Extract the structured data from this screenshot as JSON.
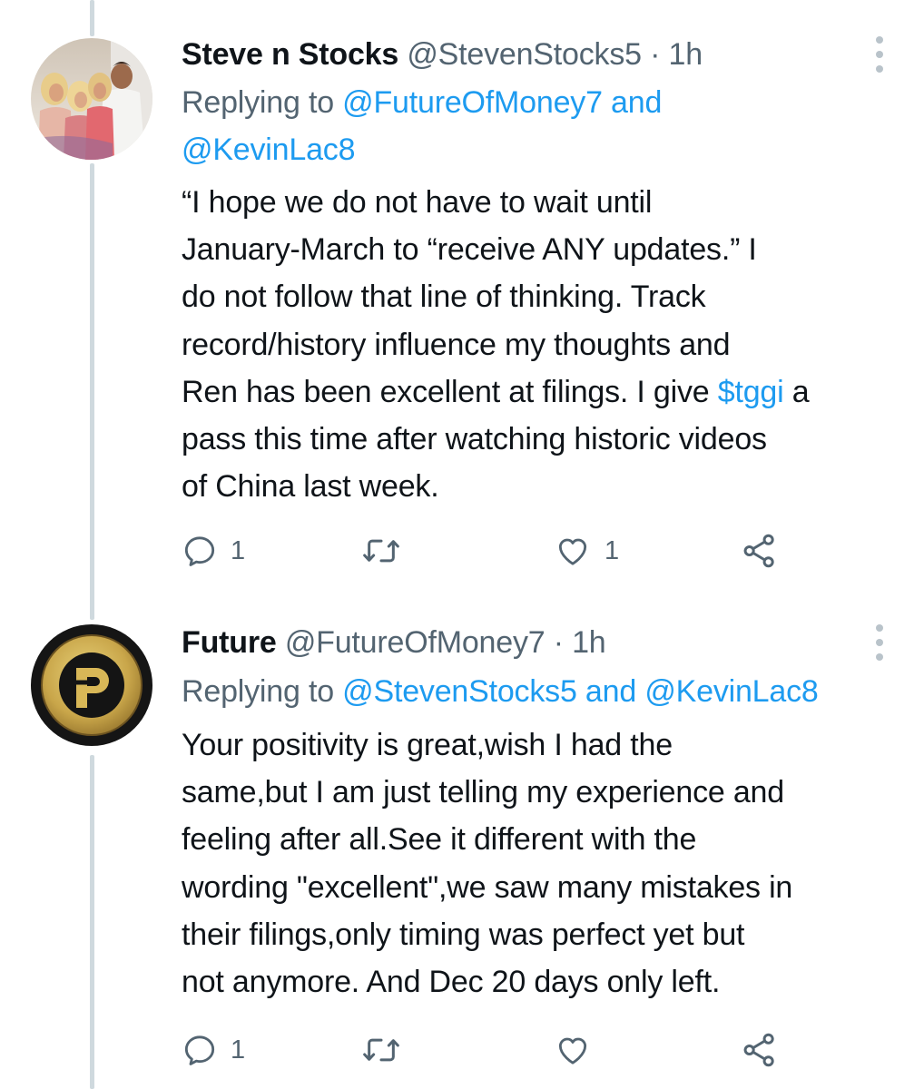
{
  "colors": {
    "link": "#1d9bf0",
    "secondary_text": "#536471",
    "thread_line": "#cfd9de",
    "primary_text": "#0f1419"
  },
  "tweets": [
    {
      "name": "Steve n Stocks",
      "handle": "@StevenStocks5",
      "separator": "·",
      "time": "1h",
      "replying_label": "Replying to",
      "mention1": "@FutureOfMoney7",
      "and_label": "and",
      "mention2": "@KevinLac8",
      "text_lines": [
        "“I hope we do not have to wait until",
        "January-March to “receive ANY updates.” I",
        "do not follow that line of thinking. Track",
        "record/history influence my thoughts  and",
        "Ren has been excellent at filings. I give ",
        "pass this time after watching historic videos",
        "of China last week."
      ],
      "cashtag": "$tggi",
      "cashtag_after": " a",
      "reply_count": "1",
      "retweet_count": "",
      "like_count": "1",
      "icons": [
        "reply-icon",
        "retweet-icon",
        "like-icon",
        "share-icon",
        "more-icon"
      ]
    },
    {
      "name": "Future",
      "handle": "@FutureOfMoney7",
      "separator": "·",
      "time": "1h",
      "replying_label": "Replying to",
      "mention1": "@StevenStocks5",
      "and_label": "and",
      "mention2": "@KevinLac8",
      "text_lines": [
        "Your positivity is great,wish I had the",
        "same,but I am just telling my experience and",
        "feeling after all.See it different with the",
        "wording \"excellent\",we saw many mistakes in",
        "their filings,only timing was perfect yet but",
        "not anymore. And Dec 20 days only left."
      ],
      "reply_count": "1",
      "retweet_count": "",
      "like_count": "",
      "icons": [
        "reply-icon",
        "retweet-icon",
        "like-icon",
        "share-icon",
        "more-icon"
      ]
    }
  ]
}
